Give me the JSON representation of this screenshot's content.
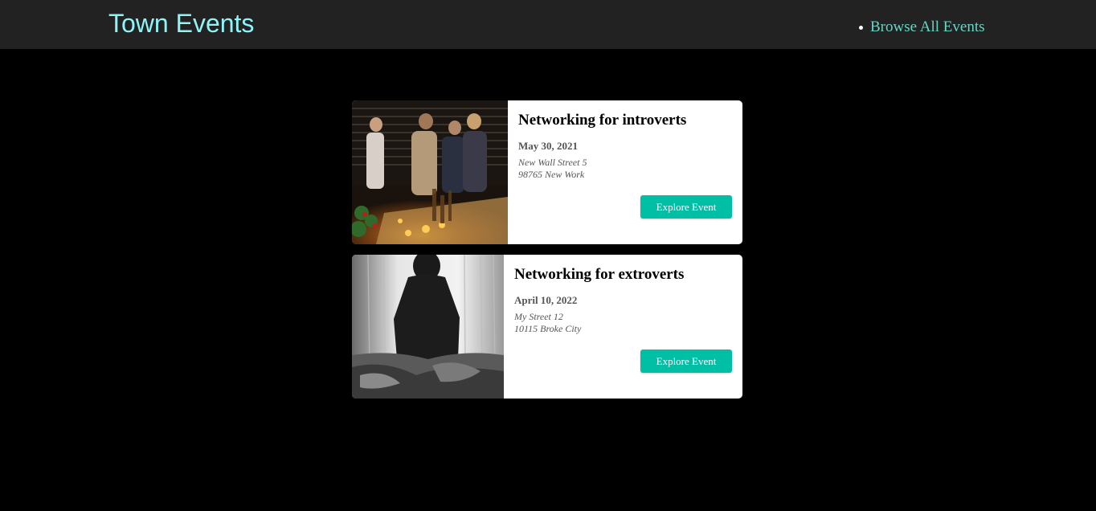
{
  "header": {
    "logo": "Town Events",
    "nav": [
      {
        "label": "Browse All Events"
      }
    ]
  },
  "events": [
    {
      "title": "Networking for introverts",
      "date": "May 30, 2021",
      "address_line1": "New Wall Street 5",
      "address_line2": "98765 New Work",
      "button_label": "Explore Event"
    },
    {
      "title": "Networking for extroverts",
      "date": "April 10, 2022",
      "address_line1": "My Street 12",
      "address_line2": "10115 Broke City",
      "button_label": "Explore Event"
    }
  ],
  "colors": {
    "header_bg": "#222222",
    "logo": "#8ff4f6",
    "nav_link": "#66d6c5",
    "button": "#00bfa5"
  }
}
